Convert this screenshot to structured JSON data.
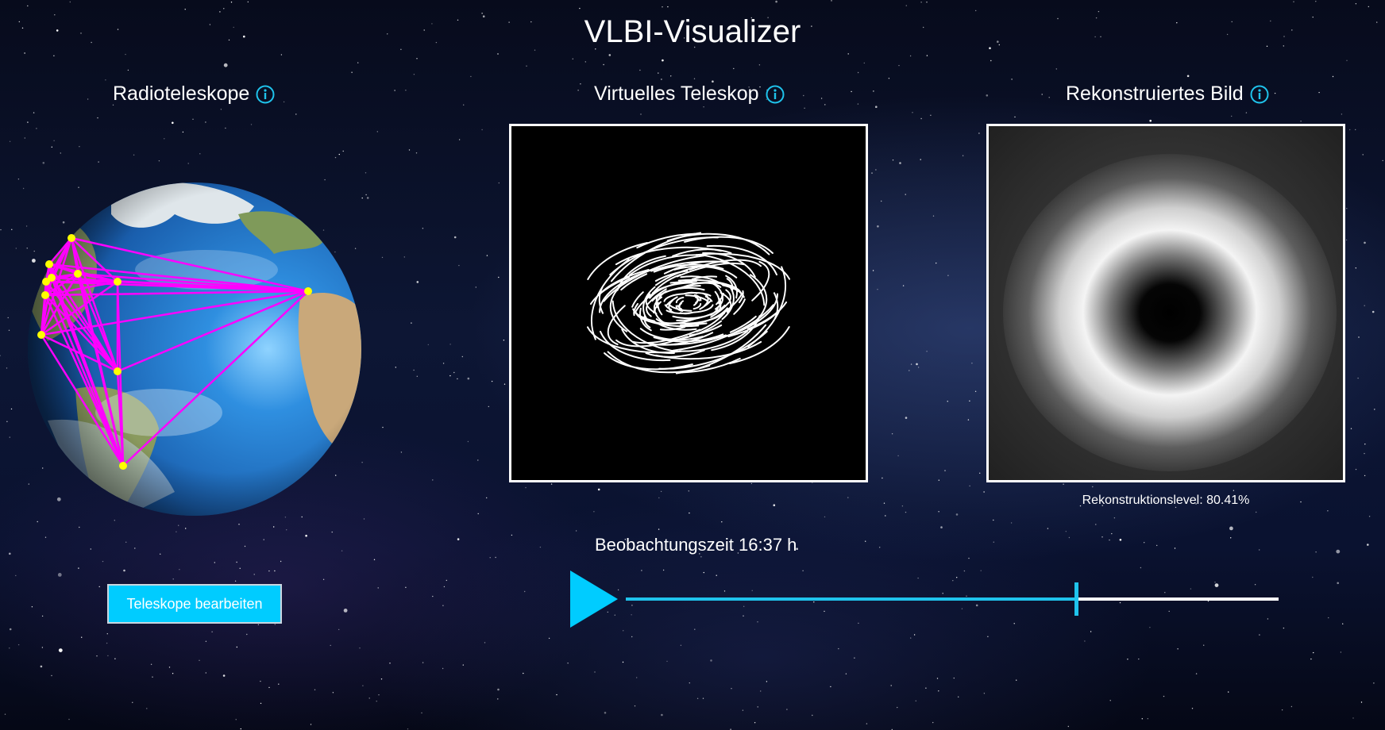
{
  "app": {
    "title": "VLBI-Visualizer"
  },
  "sections": {
    "radio": {
      "title": "Radioteleskope",
      "icon": "info-icon"
    },
    "virtual": {
      "title": "Virtuelles Teleskop",
      "icon": "info-icon"
    },
    "reconstructed": {
      "title": "Rekonstruiertes Bild",
      "icon": "info-icon"
    }
  },
  "reconstruction": {
    "label": "Rekonstruktionslevel: 80.41%"
  },
  "observation": {
    "label": "Beobachtungszeit 16:37 h",
    "progress": 0.69
  },
  "controls": {
    "edit_button": "Teleskope bearbeiten",
    "play_icon": "play-icon"
  },
  "colors": {
    "accent": "#00ccff",
    "baseline": "#ff00ff",
    "station": "#ffff00",
    "slider_fill": "#1fc3ec"
  }
}
